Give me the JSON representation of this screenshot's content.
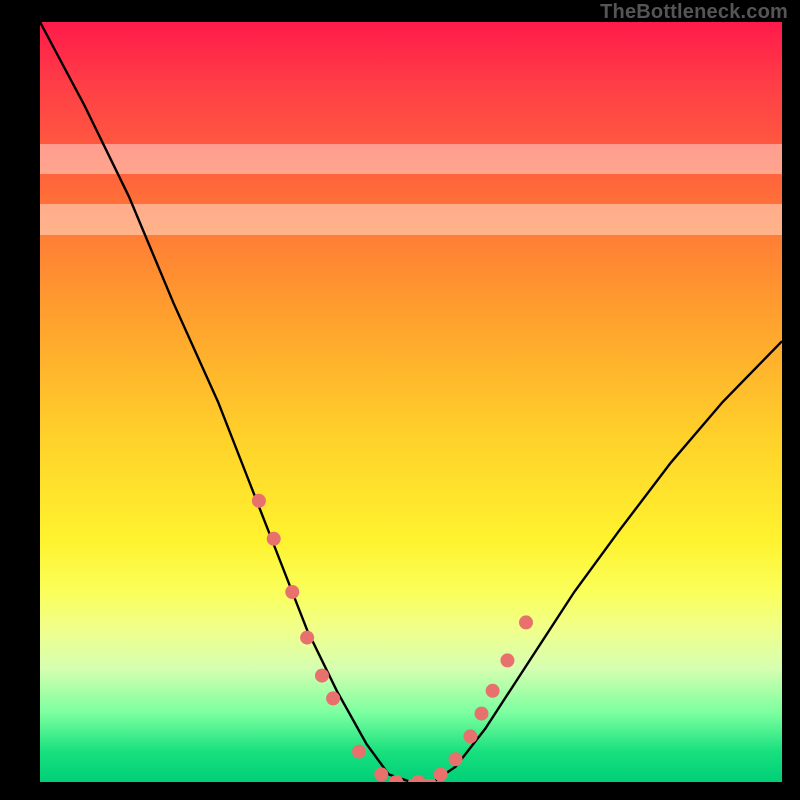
{
  "watermark": "TheBottleneck.com",
  "chart_data": {
    "type": "line",
    "title": "",
    "xlabel": "",
    "ylabel": "",
    "ylim": [
      0,
      100
    ],
    "xlim": [
      0,
      100
    ],
    "series": [
      {
        "name": "bottleneck-curve",
        "x": [
          0,
          6,
          12,
          18,
          24,
          28,
          32,
          36,
          40,
          44,
          47,
          50,
          53,
          56,
          60,
          66,
          72,
          78,
          85,
          92,
          100
        ],
        "values": [
          100,
          89,
          77,
          63,
          50,
          40,
          30,
          20,
          12,
          5,
          1,
          0,
          0,
          2,
          7,
          16,
          25,
          33,
          42,
          50,
          58
        ]
      }
    ],
    "markers": {
      "name": "sample-points",
      "x": [
        29.5,
        31.5,
        34,
        36,
        38,
        39.5,
        43,
        46,
        48,
        51,
        54,
        56,
        58,
        59.5,
        61,
        63,
        65.5
      ],
      "values": [
        37,
        32,
        25,
        19,
        14,
        11,
        4,
        1,
        0,
        0,
        1,
        3,
        6,
        9,
        12,
        16,
        21
      ]
    },
    "bands": [
      {
        "name": "pale-1",
        "y_from": 72,
        "y_to": 76
      },
      {
        "name": "pale-2",
        "y_from": 80,
        "y_to": 84
      }
    ],
    "colors": {
      "curve": "#000000",
      "marker": "#e8716e",
      "gradient_top": "#ff1a4a",
      "gradient_bottom": "#00cf78"
    }
  }
}
